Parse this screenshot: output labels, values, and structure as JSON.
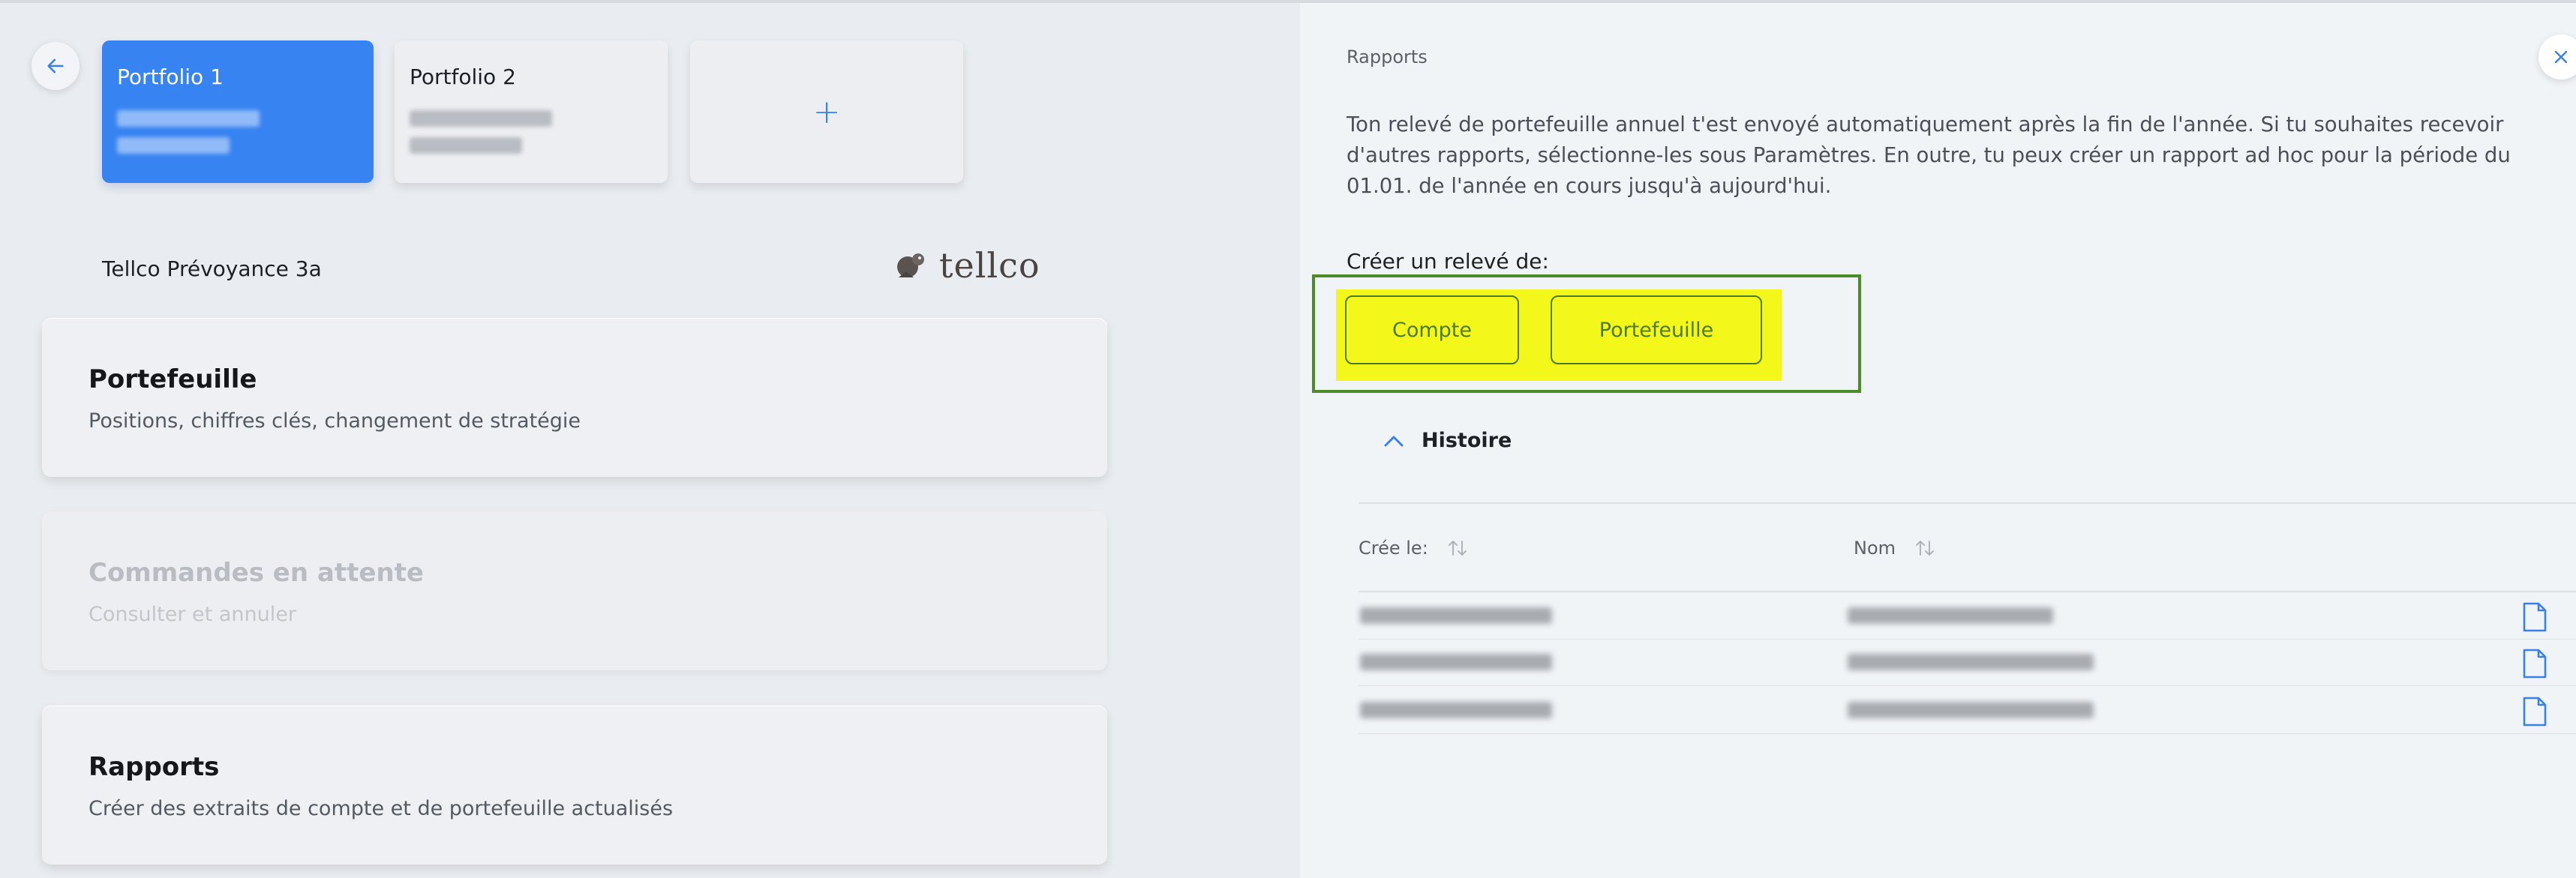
{
  "portfolio_tabs": [
    {
      "label": "Portfolio 1",
      "active": true
    },
    {
      "label": "Portfolio 2",
      "active": false
    }
  ],
  "add_portfolio_label": "+",
  "provider": {
    "name": "Tellco Prévoyance 3a",
    "logo_text": "tellco"
  },
  "menu": [
    {
      "title": "Portefeuille",
      "subtitle": "Positions, chiffres clés, changement de stratégie",
      "enabled": true
    },
    {
      "title": "Commandes en attente",
      "subtitle": "Consulter et annuler",
      "enabled": false
    },
    {
      "title": "Rapports",
      "subtitle": "Créer des extraits de compte et de portefeuille actualisés",
      "enabled": true
    }
  ],
  "reports_panel": {
    "title": "Rapports",
    "intro": "Ton relevé de portefeuille annuel t'est envoyé automatiquement après la fin de l'année. Si tu souhaites recevoir d'autres rapports, sélectionne-les sous Paramètres. En outre, tu peux créer un rapport ad hoc pour la période du 01.01. de l'année en cours jusqu'à aujourd'hui.",
    "create_label": "Créer un relevé de:",
    "buttons": [
      "Compte",
      "Portefeuille"
    ],
    "history_label": "Histoire",
    "columns": [
      "Crée le:",
      "Nom"
    ]
  },
  "colors": {
    "accent": "#3883f2",
    "highlight": "#f3f71a",
    "highlight_border": "#4d8a2a",
    "button_text": "#4d7a2d"
  },
  "icons": [
    "back-arrow-icon",
    "close-icon",
    "plus-icon",
    "chevron-up-icon",
    "sort-icon",
    "document-icon",
    "tellco-logo-icon"
  ]
}
